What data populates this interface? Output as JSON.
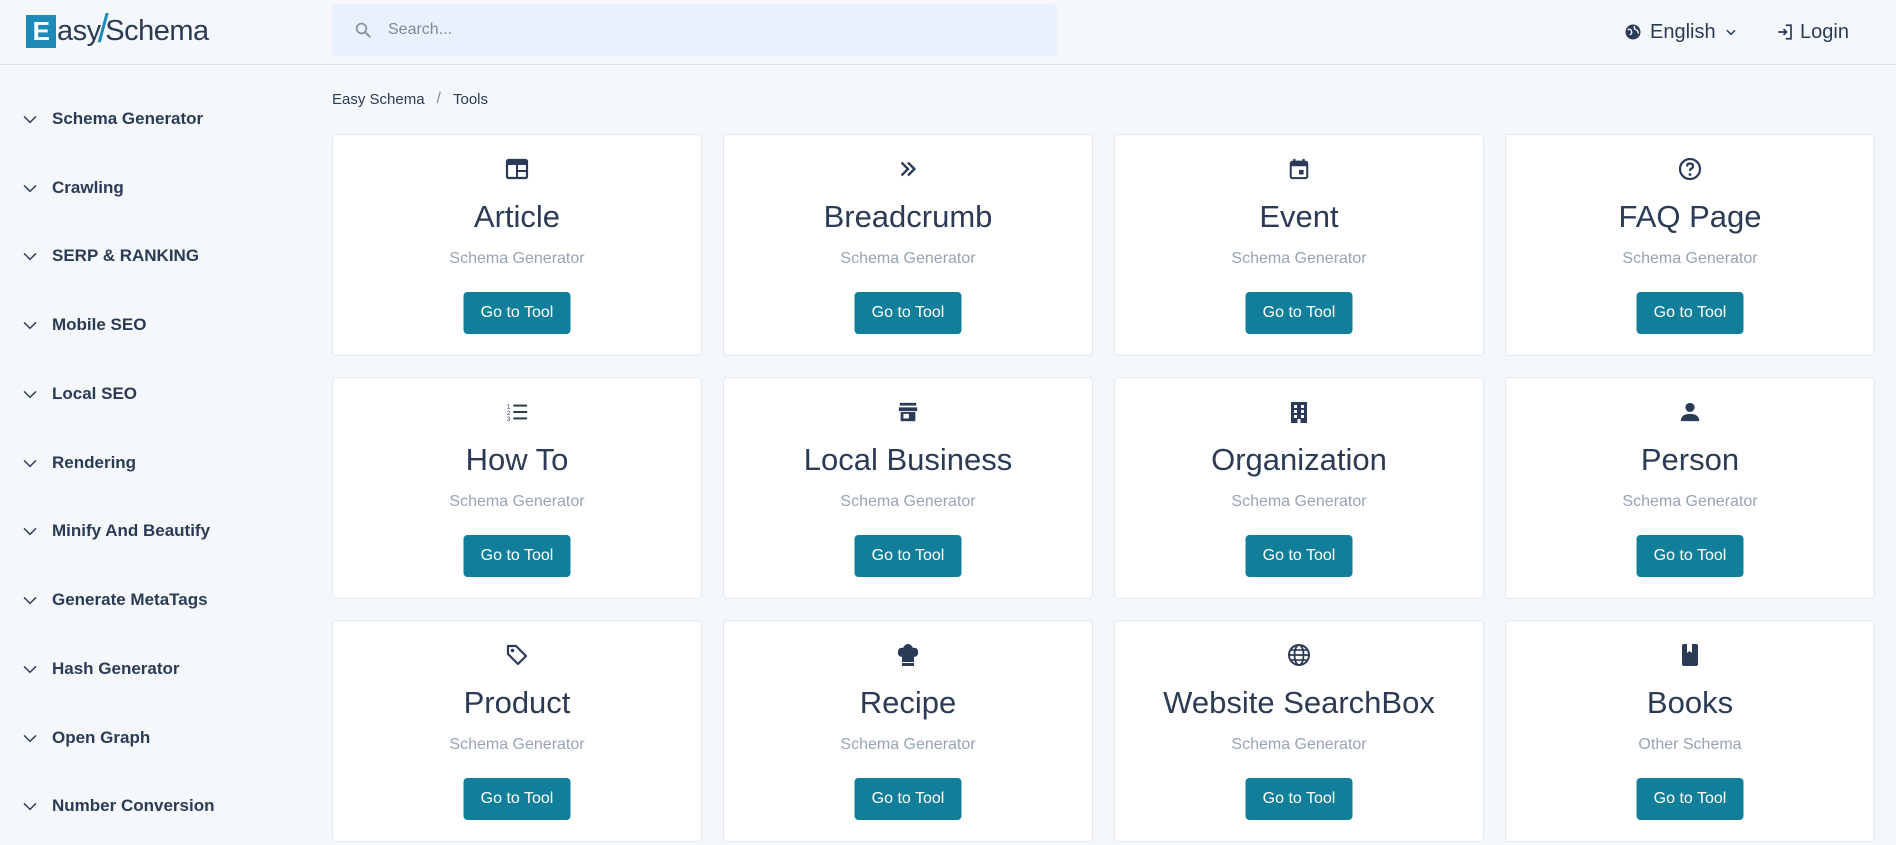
{
  "header": {
    "logo_easy": "asy",
    "logo_e": "E",
    "logo_schema": "Schema",
    "search_placeholder": "Search...",
    "language": "English",
    "login": "Login"
  },
  "sidebar": {
    "items": [
      {
        "label": "Schema Generator"
      },
      {
        "label": "Crawling"
      },
      {
        "label": "SERP & RANKING"
      },
      {
        "label": "Mobile SEO"
      },
      {
        "label": "Local SEO"
      },
      {
        "label": "Rendering"
      },
      {
        "label": "Minify And Beautify"
      },
      {
        "label": "Generate MetaTags"
      },
      {
        "label": "Hash Generator"
      },
      {
        "label": "Open Graph"
      },
      {
        "label": "Number Conversion"
      }
    ]
  },
  "breadcrumb": {
    "items": [
      "Easy Schema",
      "Tools"
    ],
    "separator": "/"
  },
  "cards": [
    {
      "title": "Article",
      "subtitle": "Schema Generator",
      "button": "Go to Tool",
      "icon": "article-icon"
    },
    {
      "title": "Breadcrumb",
      "subtitle": "Schema Generator",
      "button": "Go to Tool",
      "icon": "double-chevron-icon"
    },
    {
      "title": "Event",
      "subtitle": "Schema Generator",
      "button": "Go to Tool",
      "icon": "calendar-icon"
    },
    {
      "title": "FAQ Page",
      "subtitle": "Schema Generator",
      "button": "Go to Tool",
      "icon": "question-icon"
    },
    {
      "title": "How To",
      "subtitle": "Schema Generator",
      "button": "Go to Tool",
      "icon": "list-icon"
    },
    {
      "title": "Local Business",
      "subtitle": "Schema Generator",
      "button": "Go to Tool",
      "icon": "store-icon"
    },
    {
      "title": "Organization",
      "subtitle": "Schema Generator",
      "button": "Go to Tool",
      "icon": "building-icon"
    },
    {
      "title": "Person",
      "subtitle": "Schema Generator",
      "button": "Go to Tool",
      "icon": "person-icon"
    },
    {
      "title": "Product",
      "subtitle": "Schema Generator",
      "button": "Go to Tool",
      "icon": "tag-icon"
    },
    {
      "title": "Recipe",
      "subtitle": "Schema Generator",
      "button": "Go to Tool",
      "icon": "chef-hat-icon"
    },
    {
      "title": "Website SearchBox",
      "subtitle": "Schema Generator",
      "button": "Go to Tool",
      "icon": "globe-icon"
    },
    {
      "title": "Books",
      "subtitle": "Other Schema",
      "button": "Go to Tool",
      "icon": "book-icon"
    }
  ],
  "colors": {
    "accent": "#127f9a",
    "logo_blue": "#1d8ab8",
    "text": "#2b3a55",
    "muted": "#98a3b3"
  }
}
